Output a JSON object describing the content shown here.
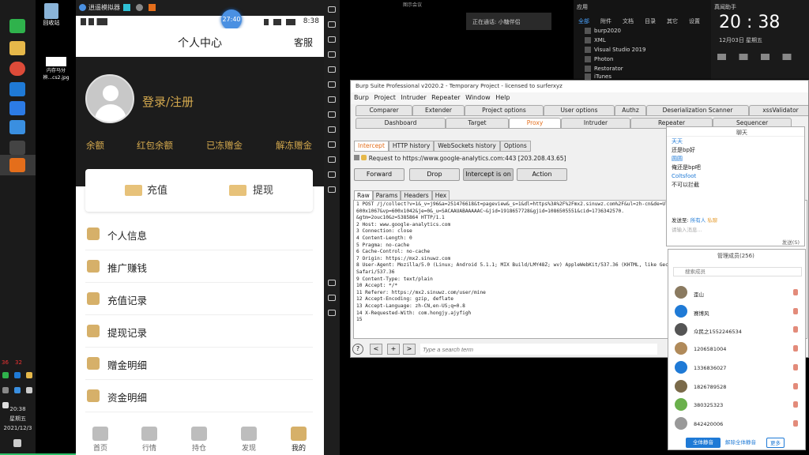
{
  "desktop": {
    "icons": [
      "回收站",
      "内存马分辨...cs2.jpg"
    ]
  },
  "taskbar": {
    "tray_nums": [
      "36",
      "32"
    ],
    "time": "20:38",
    "weekday": "星期五",
    "date": "2021/12/3"
  },
  "emulator": {
    "title": "逍遥模拟器",
    "status_time": "8:38",
    "bubble_time": "27:40"
  },
  "phone": {
    "page_title": "个人中心",
    "service": "客服",
    "login": "登录/注册",
    "balances": [
      "余额",
      "红包余额",
      "已冻赠金",
      "解冻赠金"
    ],
    "recharge": "充值",
    "withdraw": "提现",
    "menu": [
      "个人信息",
      "推广赚钱",
      "充值记录",
      "提现记录",
      "赠金明细",
      "资金明细"
    ],
    "nav": [
      "首页",
      "行情",
      "持仓",
      "发现",
      "我的"
    ]
  },
  "top": {
    "call_banner": "正在通话: 小糖伴侣",
    "top_label": "图示会议"
  },
  "start_panel": {
    "label": "应用",
    "categories": [
      "全部",
      "附件",
      "文档",
      "目录",
      "其它",
      "设置"
    ],
    "apps": [
      "burp2020",
      "XML",
      "Visual Studio 2019",
      "Photon",
      "Restorator",
      "iTunes"
    ]
  },
  "clock_panel": {
    "label": "真闻助手",
    "time": "20 : 38",
    "date": "12月03日    星期五"
  },
  "burp": {
    "title": "Burp Suite Professional v2020.2 - Temporary Project - licensed to surferxyz",
    "menu": [
      "Burp",
      "Project",
      "Intruder",
      "Repeater",
      "Window",
      "Help"
    ],
    "tabs_row1": [
      "Comparer",
      "Extender",
      "Project options",
      "User options",
      "Authz",
      "Deserialization Scanner",
      "xssValidator"
    ],
    "tabs_row2": [
      "Dashboard",
      "Target",
      "Proxy",
      "Intruder",
      "Repeater",
      "Sequencer"
    ],
    "sub_tabs": [
      "Intercept",
      "HTTP history",
      "WebSockets history",
      "Options"
    ],
    "request_line": "Request to https://www.google-analytics.com:443  [203.208.43.65]",
    "buttons": [
      "Forward",
      "Drop",
      "Intercept is on",
      "Action"
    ],
    "view_tabs": [
      "Raw",
      "Params",
      "Headers",
      "Hex"
    ],
    "lines": [
      "1 POST /j/collect?v=1&_v=j96&a=251476618&t=pageview&_s=1&dl=https%3A%2F%2Fmx2.sinuwz.com%2F&ul=zh-cn&de=UTF-8&sd=24-bit&sr=",
      "  600x1067&vp=600x1042&je=0&_u=SACAAUABAAAAAC~&jid=1918657728&gjid=1086505551&cid=1736342570.",
      "  &gtm=2ouc10&z=5385864 HTTP/1.1",
      "2 Host: www.google-analytics.com",
      "3 Connection: close",
      "4 Content-Length: 0",
      "5 Pragma: no-cache",
      "6 Cache-Control: no-cache",
      "7 Origin: https://mx2.sinuwz.com",
      "8 User-Agent: Mozilla/5.0 (Linux; Android 5.1.1; MIX Build/LMY48Z; wv) AppleWebKit/537.36 (KHTML, like Gecko)",
      "  Safari/537.36",
      "9 Content-Type: text/plain",
      "10 Accept: */*",
      "11 Referer: https://mx2.sinuwz.com/user/mine",
      "12 Accept-Encoding: gzip, deflate",
      "13 Accept-Language: zh-CN,en-US;q=0.8",
      "14 X-Requested-With: com.hongjy.ajyfigh",
      "15"
    ],
    "search_placeholder": "Type a search term"
  },
  "chat1": {
    "title": "聊天",
    "messages": [
      {
        "name": "天天",
        "text": "还是bp好"
      },
      {
        "name": "圆圆",
        "text": "俺还是bp吧"
      },
      {
        "name": "Coltsfoot",
        "text": "不可以拦截"
      }
    ],
    "compose_label": "发送至:",
    "compose_target": "所有人",
    "compose_hint": "私聊",
    "compose_placeholder": "请输入消息...",
    "send": "发送(S)"
  },
  "chat2": {
    "title": "管理成员(256)",
    "search": "搜索成员",
    "members": [
      "歪山",
      "赛博风",
      "众民之1552246534",
      "1206581004",
      "1336836027",
      "1826789528",
      "380325323",
      "842420006"
    ],
    "mute_all": "全体静音",
    "unmute_all": "解除全体静音",
    "more": "更多"
  }
}
